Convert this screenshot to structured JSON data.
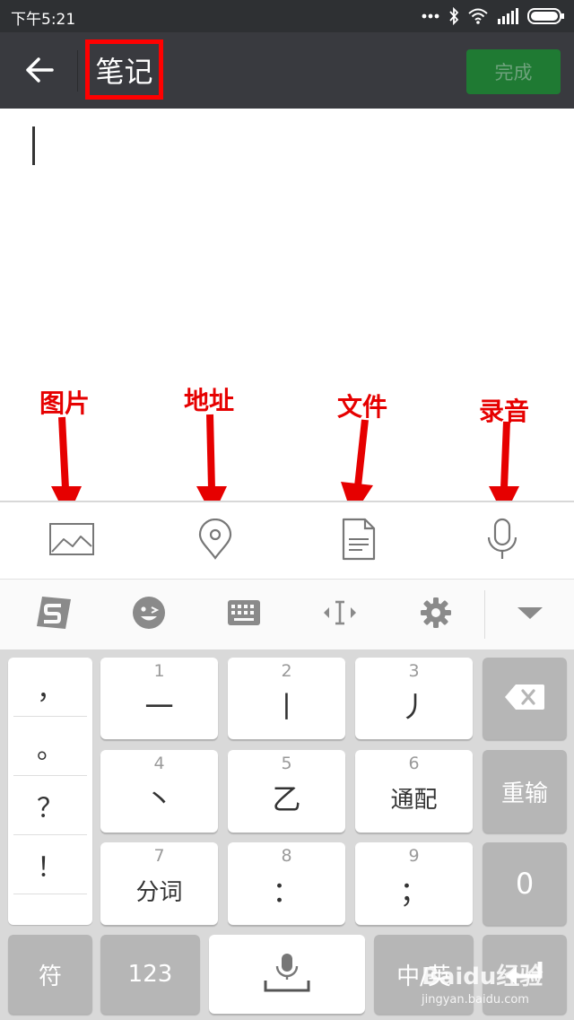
{
  "status_bar": {
    "time": "下午5:21",
    "icons": [
      "more-dots-icon",
      "bluetooth-icon",
      "wifi-icon",
      "signal-icon",
      "battery-icon"
    ]
  },
  "title_bar": {
    "back_icon": "back-arrow-icon",
    "title": "笔记",
    "done_label": "完成",
    "done_color": "#1f7a33",
    "bg_color": "#393a3f",
    "highlight_color": "#ff0000"
  },
  "annotations": {
    "color": "#e60000",
    "labels": [
      "图片",
      "地址",
      "文件",
      "录音"
    ]
  },
  "attach_toolbar": {
    "items": [
      {
        "icon": "image-icon",
        "label": "图片"
      },
      {
        "icon": "location-icon",
        "label": "地址"
      },
      {
        "icon": "file-icon",
        "label": "文件"
      },
      {
        "icon": "microphone-icon",
        "label": "录音"
      }
    ]
  },
  "ime_toolbar": {
    "items": [
      "sogou-logo-icon",
      "emoji-icon",
      "keyboard-icon",
      "cursor-move-icon",
      "settings-icon",
      "collapse-icon"
    ]
  },
  "keyboard": {
    "punctuation": [
      "，",
      "。",
      "？",
      "！"
    ],
    "keys": [
      {
        "num": "1",
        "label": "一"
      },
      {
        "num": "2",
        "label": "丨"
      },
      {
        "num": "3",
        "label": "丿"
      },
      {
        "num": "4",
        "label": "丶"
      },
      {
        "num": "5",
        "label": "乙"
      },
      {
        "num": "6",
        "label": "通配"
      },
      {
        "num": "7",
        "label": "分词"
      },
      {
        "num": "8",
        "label": "："
      },
      {
        "num": "9",
        "label": "；"
      }
    ],
    "side": {
      "backspace_icon": "backspace-icon",
      "reinput": "重输",
      "zero": "0"
    },
    "bottom": {
      "symbols": "符",
      "numbers": "123",
      "space_icon": "mic-space-icon",
      "lang": "中/英",
      "enter_icon": "enter-icon"
    }
  },
  "watermark": {
    "main": "Baidu经验",
    "sub": "jingyan.baidu.com"
  }
}
